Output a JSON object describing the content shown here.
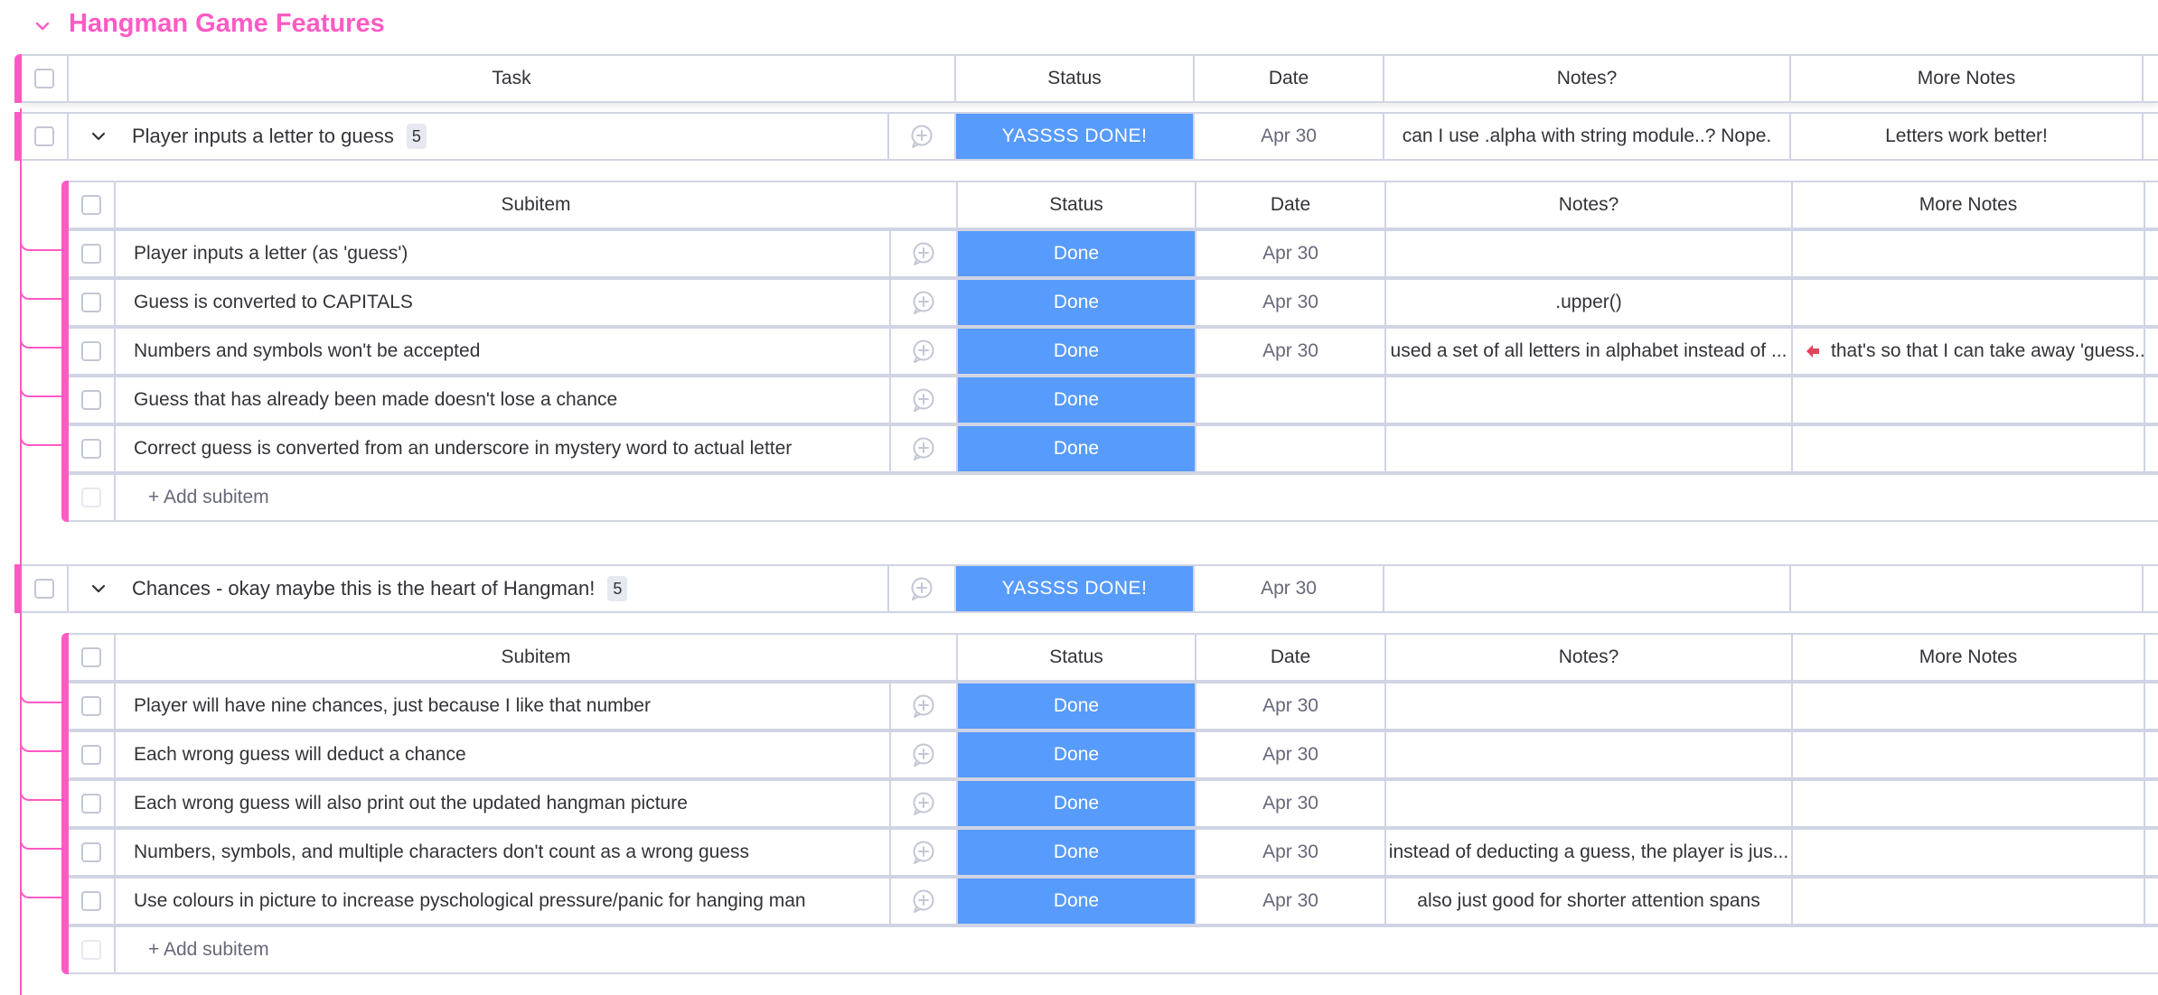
{
  "group": {
    "title": "Hangman Game Features",
    "color": "#ff5ac4"
  },
  "columns": {
    "task": "Task",
    "status": "Status",
    "date": "Date",
    "notes": "Notes?",
    "more_notes": "More Notes"
  },
  "sub_columns": {
    "subitem": "Subitem",
    "status": "Status",
    "date": "Date",
    "notes": "Notes?",
    "more_notes": "More Notes"
  },
  "items": [
    {
      "name": "Player inputs a letter to guess",
      "count": "5",
      "status": "YASSSS DONE!",
      "date": "Apr 30",
      "notes": "can I use .alpha with string module..? Nope.",
      "more_notes": "Letters work better!",
      "subitems": [
        {
          "name": "Player inputs a letter (as 'guess')",
          "status": "Done",
          "date": "Apr 30",
          "notes": "",
          "more_notes": ""
        },
        {
          "name": "Guess is converted to CAPITALS",
          "status": "Done",
          "date": "Apr 30",
          "notes": ".upper()",
          "more_notes": ""
        },
        {
          "name": "Numbers and symbols won't be accepted",
          "status": "Done",
          "date": "Apr 30",
          "notes": "used a set of all letters in alphabet instead of ...",
          "more_notes": "that's so that I can take away 'guess..."
        },
        {
          "name": "Guess that has already been made doesn't lose a chance",
          "status": "Done",
          "date": "",
          "notes": "",
          "more_notes": ""
        },
        {
          "name": "Correct guess is converted from an underscore in mystery word to actual letter",
          "status": "Done",
          "date": "",
          "notes": "",
          "more_notes": ""
        }
      ],
      "add_label": "+ Add subitem"
    },
    {
      "name": "Chances - okay maybe this is the heart of Hangman!",
      "count": "5",
      "status": "YASSSS DONE!",
      "date": "Apr 30",
      "notes": "",
      "more_notes": "",
      "subitems": [
        {
          "name": "Player will have nine chances, just because I like that number",
          "status": "Done",
          "date": "Apr 30",
          "notes": "",
          "more_notes": ""
        },
        {
          "name": "Each wrong guess will deduct a chance",
          "status": "Done",
          "date": "Apr 30",
          "notes": "",
          "more_notes": ""
        },
        {
          "name": "Each wrong guess will also print out the updated hangman picture",
          "status": "Done",
          "date": "Apr 30",
          "notes": "",
          "more_notes": ""
        },
        {
          "name": "Numbers, symbols, and multiple characters don't count as a wrong guess",
          "status": "Done",
          "date": "Apr 30",
          "notes": "instead of deducting a guess, the player is jus...",
          "more_notes": ""
        },
        {
          "name": "Use colours in picture to increase pyschological pressure/panic for hanging man",
          "status": "Done",
          "date": "Apr 30",
          "notes": "also just good for shorter attention spans",
          "more_notes": ""
        }
      ],
      "add_label": "+ Add subitem"
    }
  ],
  "colors": {
    "status_done": "#579bfc",
    "accent": "#ff5ac4",
    "arrow": "#e2445c"
  }
}
